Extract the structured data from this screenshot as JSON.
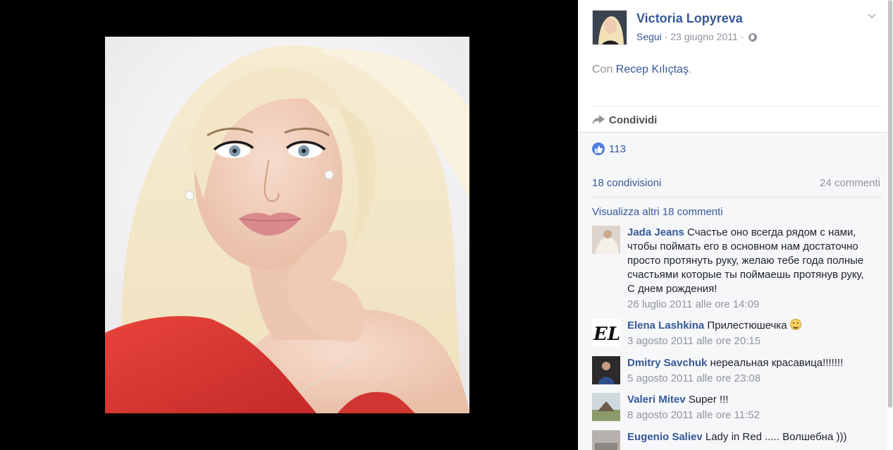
{
  "post": {
    "author": "Victoria Lopyreva",
    "follow_label": "Segui",
    "meta_sep": " · ",
    "date": "23 giugno 2011",
    "meta_tail": " · ",
    "with_prefix": "Con ",
    "tagged": "Recep Kılıçtaş",
    "with_suffix": ".",
    "share_label": "Condividi"
  },
  "stats": {
    "likes": "113",
    "shares": "18 condivisioni",
    "comments": "24 commenti",
    "view_more": "Visualizza altri 18 commenti"
  },
  "comments": [
    {
      "author": "Jada Jeans",
      "text": " Счастье оно всегда рядом с нами, чтобы поймать его в основном нам достаточно просто протянуть руку, желаю тебе года полные счастьями которые ты поймаешь протянув руку, С днем рождения!",
      "time": "26 luglio 2011 alle ore 14:09"
    },
    {
      "author": "Elena Lashkina",
      "text": " Прилестюшечка ",
      "time": "3 agosto 2011 alle ore 20:15",
      "avatar_text": "EL"
    },
    {
      "author": "Dmitry Savchuk",
      "text": " нереальная красавица!!!!!!!",
      "time": "5 agosto 2011 alle ore 23:08"
    },
    {
      "author": "Valeri Mitev",
      "text": " Super !!!",
      "time": "8 agosto 2011 alle ore 11:52"
    },
    {
      "author": "Eugenio Saliev",
      "text": " Lady in Red ..... Волшебна )))",
      "time": ""
    }
  ],
  "colors": {
    "link": "#365899",
    "muted": "#90949c",
    "like_blue": "#4f7de0",
    "dress_red": "#d93a35"
  },
  "icons": [
    "globe-icon",
    "chevron-down-icon",
    "share-arrow-icon",
    "like-icon",
    "smiley-icon"
  ]
}
